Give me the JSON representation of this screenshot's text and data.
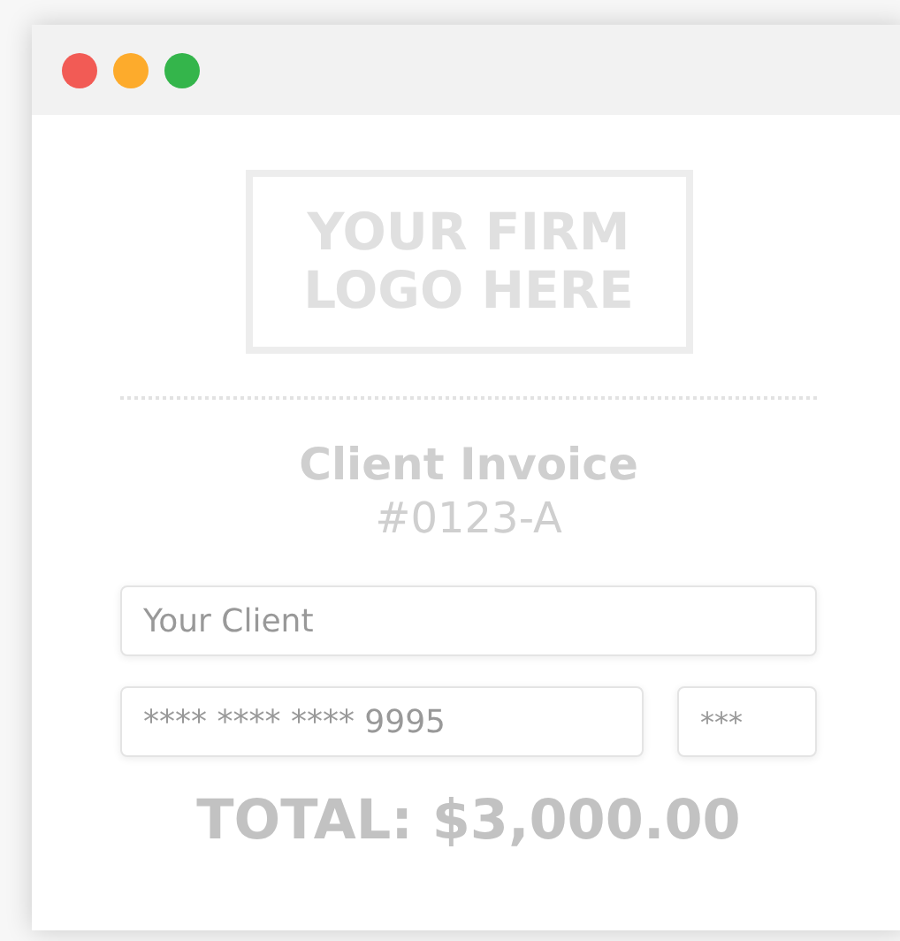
{
  "window": {
    "controls": [
      {
        "kind": "close",
        "color": "#f25b55"
      },
      {
        "kind": "minimize",
        "color": "#fdab2c"
      },
      {
        "kind": "maximize",
        "color": "#34b54b"
      }
    ]
  },
  "logo": {
    "lines": [
      "YOUR FIRM",
      "LOGO HERE"
    ]
  },
  "invoice": {
    "title": "Client Invoice",
    "number": "#0123-A"
  },
  "client_field": {
    "placeholder": "Your Client"
  },
  "card_field": {
    "value": "**** **** **** 9995"
  },
  "cvc_field": {
    "value": "***"
  },
  "total": "TOTAL: $3,000.00"
}
